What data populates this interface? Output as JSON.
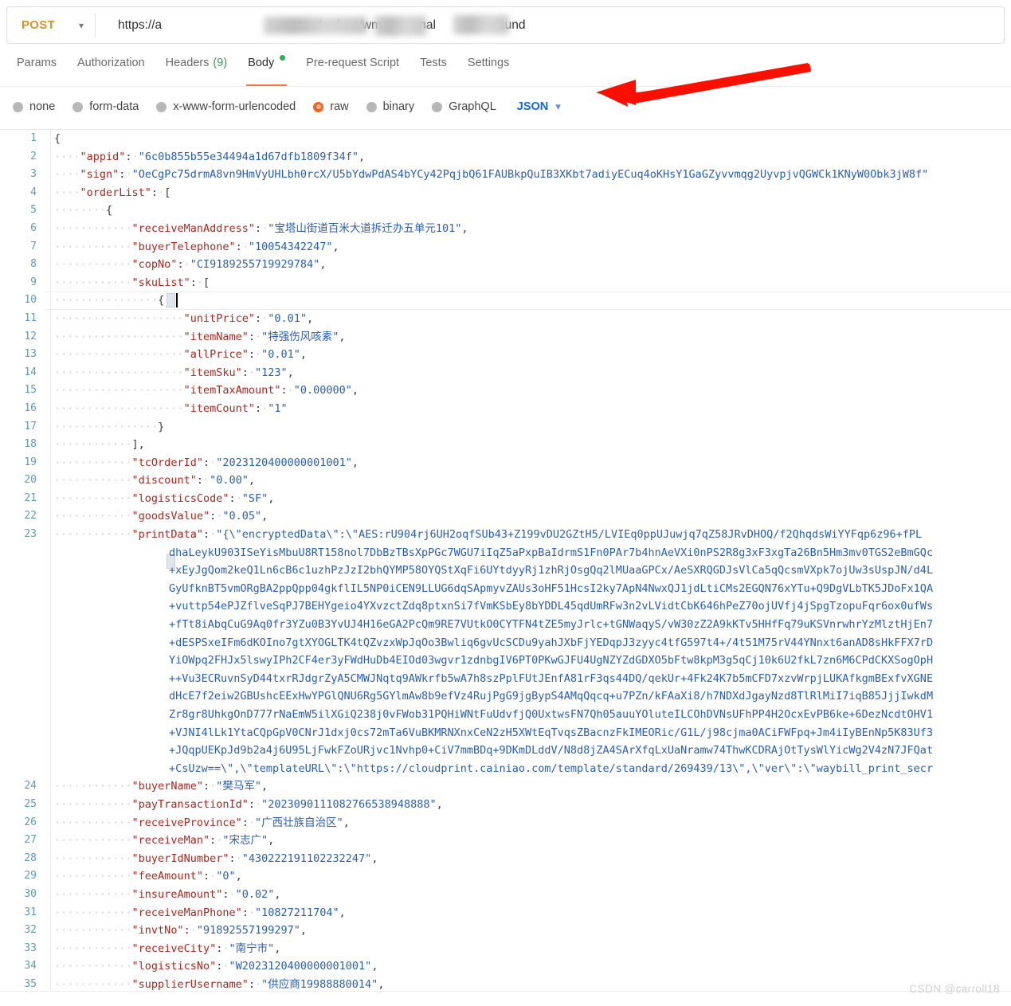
{
  "request": {
    "method": "POST",
    "method_chevron": "chevron-down",
    "url_prefix": "https://",
    "url_visible_mid": "s-standard-ws/wms-external",
    "url_visible_suffix": "ound",
    "url_redacted": true
  },
  "tabs": [
    {
      "label": "Params",
      "active": false
    },
    {
      "label": "Authorization",
      "active": false
    },
    {
      "label": "Headers",
      "count": "(9)",
      "active": false
    },
    {
      "label": "Body",
      "active": true,
      "has_dot": true
    },
    {
      "label": "Pre-request Script",
      "active": false
    },
    {
      "label": "Tests",
      "active": false
    },
    {
      "label": "Settings",
      "active": false
    }
  ],
  "body_types": [
    {
      "label": "none",
      "selected": false
    },
    {
      "label": "form-data",
      "selected": false
    },
    {
      "label": "x-www-form-urlencoded",
      "selected": false
    },
    {
      "label": "raw",
      "selected": true
    },
    {
      "label": "binary",
      "selected": false
    },
    {
      "label": "GraphQL",
      "selected": false
    }
  ],
  "format_select": {
    "label": "JSON",
    "chevron": "chevron-down"
  },
  "colors": {
    "accent_orange": "#f26522",
    "tab_underline": "#f0774a",
    "method_text": "#d99326",
    "json_blue": "#1565d8",
    "key_red": "#a8291f",
    "string_blue": "#2b5fb0",
    "linenum": "#5e9cb5",
    "body_dot_green": "#2ab14f",
    "arrow_red": "#fa0f00"
  },
  "annotation": {
    "type": "red-arrow",
    "points_to": "JSON format selector"
  },
  "watermark": "CSDN @carroll18",
  "editor": {
    "active_line": 10,
    "visible_line_numbers": [
      1,
      2,
      3,
      4,
      5,
      6,
      7,
      8,
      9,
      10,
      11,
      12,
      13,
      14,
      15,
      16,
      17,
      18,
      19,
      20,
      21,
      22,
      23,
      24,
      25,
      26,
      27,
      28,
      29,
      30,
      31,
      32,
      33,
      34,
      35
    ],
    "lines": [
      {
        "n": 1,
        "indent": 0,
        "key": "",
        "text_raw": "{"
      },
      {
        "n": 2,
        "indent": 1,
        "key": "appid",
        "value": "6c0b855b55e34494a1d67dfb1809f34f",
        "trail": ","
      },
      {
        "n": 3,
        "indent": 1,
        "key": "sign",
        "value": "OeCgPc75drmA8vn9HmVyUHLbh0rcX/U5bYdwPdAS4bYCy42PqjbQ61FAUBkpQuIB3XKbt7adiyECuq4oKHsY1GaGZyvvmqg2UyvpjvQGWCk1KNyW0Obk3jW8f",
        "trail": "",
        "clipped": true
      },
      {
        "n": 4,
        "indent": 1,
        "key": "orderList",
        "text_raw": "\"orderList\": ["
      },
      {
        "n": 5,
        "indent": 2,
        "text_raw": "{"
      },
      {
        "n": 6,
        "indent": 3,
        "key": "receiveManAddress",
        "value": "宝塔山街道百米大道拆迁办五单元101",
        "trail": ","
      },
      {
        "n": 7,
        "indent": 3,
        "key": "buyerTelephone",
        "value": "10054342247",
        "trail": ","
      },
      {
        "n": 8,
        "indent": 3,
        "key": "copNo",
        "value": "CI9189255719929784",
        "trail": ","
      },
      {
        "n": 9,
        "indent": 3,
        "key": "skuList",
        "text_raw": "\"skuList\": ["
      },
      {
        "n": 10,
        "indent": 4,
        "text_raw": "{"
      },
      {
        "n": 11,
        "indent": 5,
        "key": "unitPrice",
        "value": "0.01",
        "trail": ","
      },
      {
        "n": 12,
        "indent": 5,
        "key": "itemName",
        "value": "特强伤风咳素",
        "trail": ","
      },
      {
        "n": 13,
        "indent": 5,
        "key": "allPrice",
        "value": "0.01",
        "trail": ","
      },
      {
        "n": 14,
        "indent": 5,
        "key": "itemSku",
        "value": "123",
        "trail": ","
      },
      {
        "n": 15,
        "indent": 5,
        "key": "itemTaxAmount",
        "value": "0.00000",
        "trail": ","
      },
      {
        "n": 16,
        "indent": 5,
        "key": "itemCount",
        "value": "1",
        "trail": ""
      },
      {
        "n": 17,
        "indent": 4,
        "text_raw": "}"
      },
      {
        "n": 18,
        "indent": 3,
        "text_raw": "],"
      },
      {
        "n": 19,
        "indent": 3,
        "key": "tcOrderId",
        "value": "2023120400000001001",
        "trail": ","
      },
      {
        "n": 20,
        "indent": 3,
        "key": "discount",
        "value": "0.00",
        "trail": ","
      },
      {
        "n": 21,
        "indent": 3,
        "key": "logisticsCode",
        "value": "SF",
        "trail": ","
      },
      {
        "n": 22,
        "indent": 3,
        "key": "goodsValue",
        "value": "0.05",
        "trail": ","
      },
      {
        "n": 23,
        "indent": 3,
        "key": "printData",
        "value": "WRAPPED",
        "trail": ","
      },
      {
        "n": 24,
        "indent": 3,
        "key": "buyerName",
        "value": "樊马军",
        "trail": ","
      },
      {
        "n": 25,
        "indent": 3,
        "key": "payTransactionId",
        "value": "20230901110827665389​48888",
        "trail": ","
      },
      {
        "n": 26,
        "indent": 3,
        "key": "receiveProvince",
        "value": "广西壮族自治区",
        "trail": ","
      },
      {
        "n": 27,
        "indent": 3,
        "key": "receiveMan",
        "value": "宋志广",
        "trail": ","
      },
      {
        "n": 28,
        "indent": 3,
        "key": "buyerIdNumber",
        "value": "430222191102232247",
        "trail": ","
      },
      {
        "n": 29,
        "indent": 3,
        "key": "feeAmount",
        "value": "0",
        "trail": ","
      },
      {
        "n": 30,
        "indent": 3,
        "key": "insureAmount",
        "value": "0.02",
        "trail": ","
      },
      {
        "n": 31,
        "indent": 3,
        "key": "receiveManPhone",
        "value": "10827211704",
        "trail": ","
      },
      {
        "n": 32,
        "indent": 3,
        "key": "invtNo",
        "value": "91892557199297",
        "trail": ","
      },
      {
        "n": 33,
        "indent": 3,
        "key": "receiveCity",
        "value": "南宁市",
        "trail": ","
      },
      {
        "n": 34,
        "indent": 3,
        "key": "logisticsNo",
        "value": "W2023120400000001001",
        "trail": ","
      },
      {
        "n": 35,
        "indent": 3,
        "key": "supplierUsername",
        "value": "供应商19988880014",
        "trail": ","
      }
    ],
    "printData_wrapped": [
      "\"printData\": \"{\\\"encryptedData\\\":\\\"AES:rU904rj6UH2oqfSUb43+Z199vDU2GZtH5/LVIEq0ppUJuwjq7qZ58JRvDHOQ/f2QhqdsWiYYFqp6z96+fPL",
      "dhaLeykU903ISeYisMbuU8RT158nol7DbBzTBsXpPGc7WGU7iIqZ5aPxpBaIdrmS1Fn0PAr7b4hnAeVXi0nPS2R8g3xF3xgTa26Bn5Hm3mv0TGS2eBmGQc",
      "+xEyJgQom2keQ1Ln6cB6c1uzhPzJzI2bhQYMP58OYQStXqFi6UYtdyyRj1zhRjOsgQq2lMUaaGPCx/AeSXRQGDJsVlCa5qQcsmVXpk7ojUw3sUspJN/d4L",
      "GyUfknBT5vmORgBA2ppQpp04gkflIL5NP0iCEN9LLUG6dqSApmyvZAUs3oHF51HcsI2ky7ApN4NwxQJ1jdLtiCMs2EGQN76xYTu+Q9DgVLbTK5JDoFx1QA",
      "+vuttp54ePJZflveSqPJ7BEHYgeio4YXvzctZdq8ptxnSi7fVmKSbEy8bYDDL45qdUmRFw3n2vLVidtCbK646hPeZ70ojUVfj4jSpgTzopuFqr6ox0ufWs",
      "+fTt8iAbqCuG9Aq0fr3YZu0B3YvUJ4H16eGA2PcQm9RE7VUtkO0CYTFN4tZE5myJrlc+tGNWaqyS/vW30zZ2A9kKTv5HHfFq79uKSVnrwhrYzMlztHjEn7",
      "+dESPSxeIFm6dKOIno7gtXYOGLTK4tQZvzxWpJqOo3Bwliq6gvUcSCDu9yahJXbFjYEDqpJ3zyyc4tfG597t4+/4t51M75rV44YNnxt6anAD8sHkFFX7rD",
      "YiOWpq2FHJx5lswyIPh2CF4er3yFWdHuDb4EIOd03wgvr1zdnbgIV6PT0PKwGJFU4UgNZYZdGDXO5bFtw8kpM3g5qCj10k6U2fkL7zn6M6CPdCKXSogOpH",
      "++Vu3ECRuvnSyD44txrRJdgrZyA5CMWJNqtq9AWkrfb5wA7h8szPplFUtJEnfA81rF3qs44DQ/qekUr+4Fk24K7b5mCFD7xzvWrpjLUKAfkgmBExfvXGNE",
      "dHcE7f2eiw2GBUshcEExHwYPGlQNU6Rg5GYlmAw8b9efVz4RujPgG9jgBypS4AMqQqcq+u7PZn/kFAaXi8/h7NDXdJgayNzd8TlRlMiI7iqB85JjjIwkdM",
      "Zr8gr8UhkgOnD777rNaEmW5ilXGiQ238j0vFWob31PQHiWNtFuUdvfjQ0UxtwsFN7Qh05auuYOluteILCOhDVNsUFhPP4H2OcxEvPB6ke+6DezNcdtOHV1",
      "+VJNI4lLk1YtaCQpGpV0CNrJ1dxj0cs72mTa6VuBKMRNXnxCeN2zH5XWtEqTvqsZBacnzFkIMEORic/G1L/j98cjma0ACiFWFpq+Jm4iIyBEnNp5K83Uf3",
      "+JQqpUEKpJd9b2a4j6U95LjFwkFZoURjvc1Nvhp0+CiV7mmBDq+9DKmDLddV/N8d8jZA4SArXfqLxUaNramw74ThwKCDRAjOtTysWlYicWg2V4zN7JFQat",
      "+CsUzw==\\\",\\\"templateURL\\\":\\\"https://cloudprint.cainiao.com/template/standard/269439/13\\\",\\\"ver\\\":\\\"waybill_print_secr"
    ]
  }
}
